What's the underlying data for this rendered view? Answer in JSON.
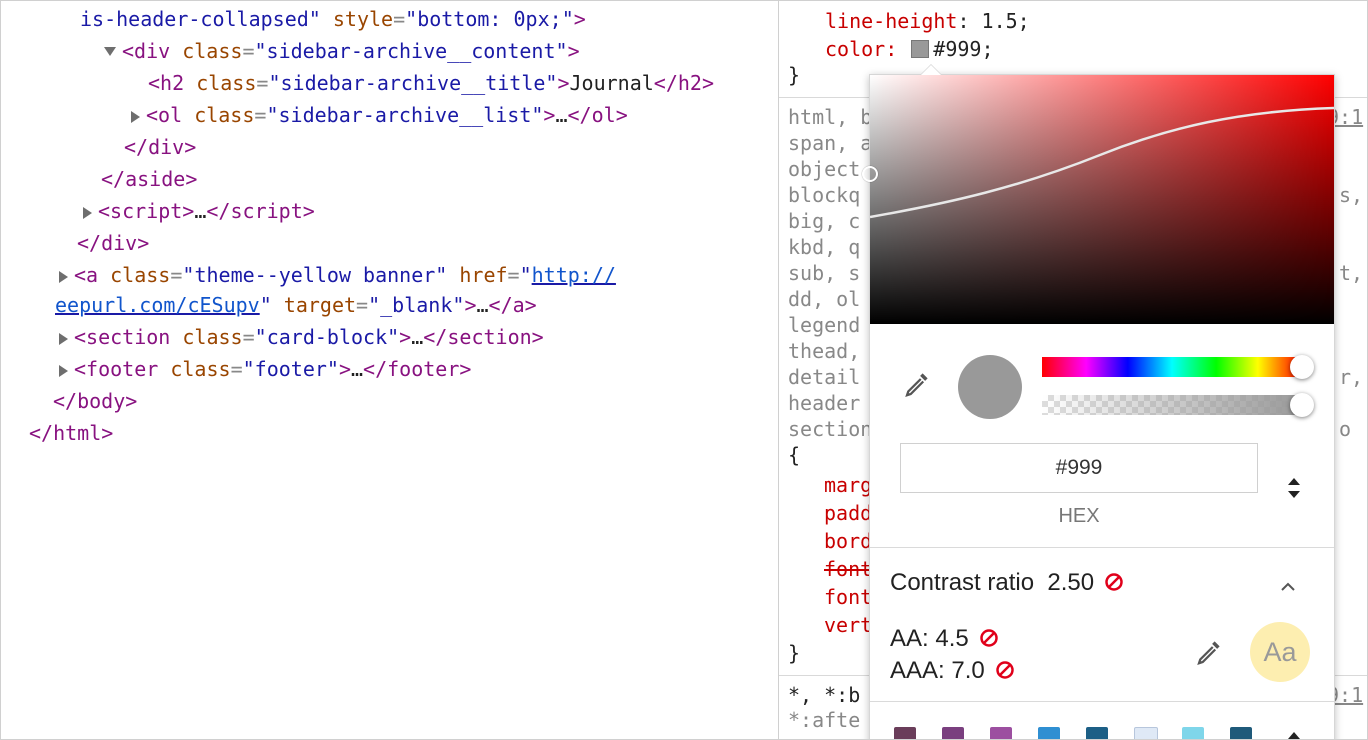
{
  "dom_tree": {
    "l1_value": "is-header-collapsed",
    "l1_attr": "style",
    "l1_attr_value": "bottom: 0px;",
    "l2_tag": "div",
    "l2_attr": "class",
    "l2_value": "sidebar-archive__content",
    "l3_tag": "h2",
    "l3_attr": "class",
    "l3_value": "sidebar-archive__title",
    "l3_text": "Journal",
    "l4_tag": "ol",
    "l4_attr": "class",
    "l4_value": "sidebar-archive__list",
    "ellipsis": "…",
    "l5_tag": "div",
    "l6_tag": "aside",
    "l7_tag": "script",
    "l8_tag": "div",
    "l9_tag": "a",
    "l9_attr1": "class",
    "l9_value1": "theme--yellow banner",
    "l9_attr2": "href",
    "l9_href1": "http://",
    "l10_href2": "eepurl.com/cESupv",
    "l10_attr3": "target",
    "l10_value3": "_blank",
    "l11_tag": "section",
    "l11_attr": "class",
    "l11_value": "card-block",
    "l12_tag": "footer",
    "l12_attr": "class",
    "l12_value": "footer",
    "l13_tag": "body",
    "l14_tag": "html"
  },
  "styles": {
    "line_height": "line-height: 1.5;",
    "color_name": "color:",
    "color_value": "#999;",
    "close_brace": "}",
    "selectors": [
      "html, b",
      "span, a",
      "object",
      "blockq",
      "big, c",
      "kbd, q",
      "sub, s",
      "dd, ol",
      "legend",
      "thead,",
      "detail",
      "header",
      "section"
    ],
    "right_frags": [
      "9:1",
      ",",
      "s,",
      "t,",
      "r,",
      "o"
    ],
    "open_brace": "{",
    "props": [
      "marg",
      "padd",
      "bord",
      "font",
      "font",
      "vert"
    ],
    "close2": "}",
    "rule3": "*, *:b",
    "rule3_src": "9:1",
    "rule3_line2": "*:afte"
  },
  "picker": {
    "hex_value": "#999",
    "format_label": "HEX",
    "contrast_label": "Contrast ratio",
    "contrast_value": "2.50",
    "aa_label": "AA: 4.5",
    "aaa_label": "AAA: 7.0",
    "sample_text": "Aa",
    "current_color": "#999999",
    "palette": [
      "#6a3d5a",
      "#7a3f7f",
      "#9c4fa0",
      "#2f8fd2",
      "#1c5f86",
      "#dfe9f6",
      "#7fd6ea",
      "#1f5a7a"
    ]
  }
}
